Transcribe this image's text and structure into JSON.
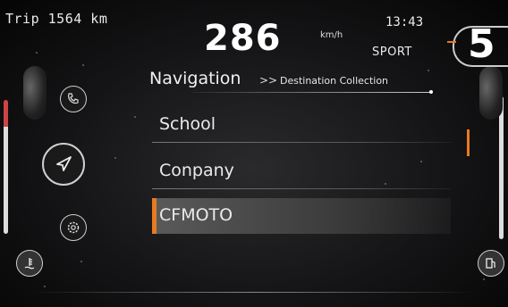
{
  "status": {
    "trip_label": "Trip 1564 km",
    "clock": "13:43",
    "speed": "286",
    "speed_unit": "km/h",
    "ride_mode": "SPORT",
    "gear": "5"
  },
  "header": {
    "title": "Navigation",
    "separator": ">>",
    "subtitle": "Destination Collection"
  },
  "destinations": [
    {
      "label": "School",
      "selected": false
    },
    {
      "label": "Conpany",
      "selected": false
    },
    {
      "label": "CFMOTO",
      "selected": true
    }
  ],
  "side_menu": {
    "icons": [
      "phone-icon",
      "navigation-arrow-icon",
      "settings-gear-icon",
      "coolant-temperature-icon",
      "fuel-pump-icon"
    ],
    "active": "navigation-arrow-icon"
  },
  "colors": {
    "accent": "#e87a20",
    "selected_bg": "#4a4a4a",
    "text": "#eaeaea"
  }
}
